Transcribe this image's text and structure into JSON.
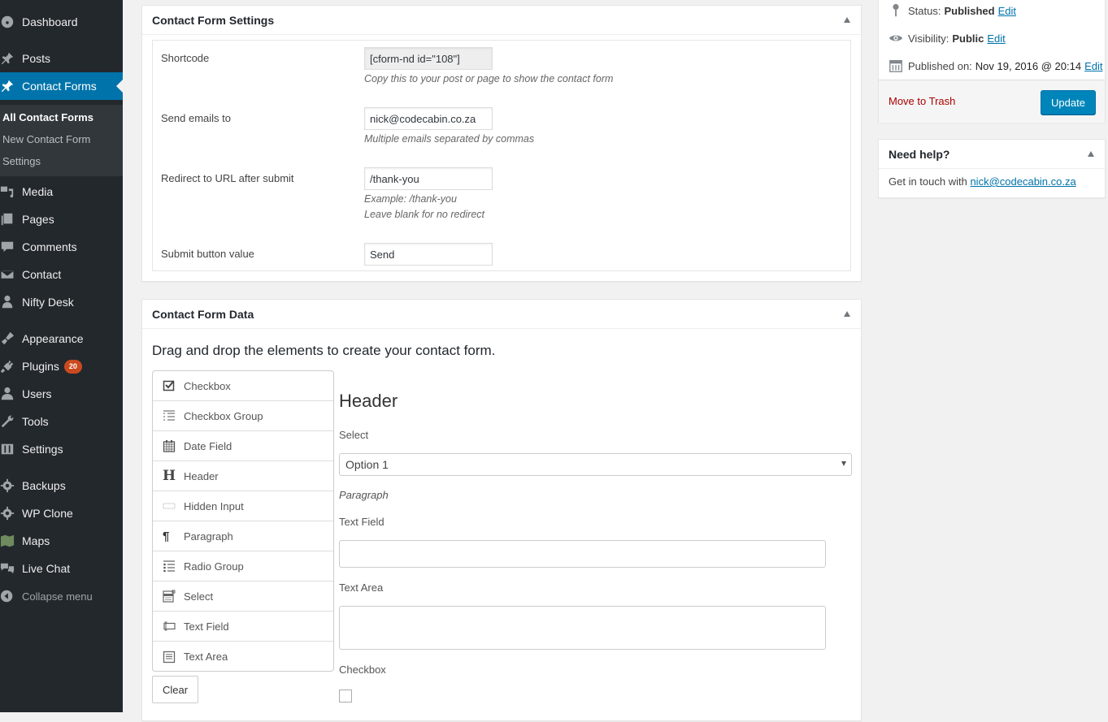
{
  "sidebar": {
    "items": [
      {
        "label": "Dashboard",
        "icon": "dashboard-icon"
      },
      {
        "label": "Posts",
        "icon": "pin-icon"
      },
      {
        "label": "Contact Forms",
        "icon": "pin-icon",
        "current": true
      },
      {
        "label": "Media",
        "icon": "media-icon"
      },
      {
        "label": "Pages",
        "icon": "pages-icon"
      },
      {
        "label": "Comments",
        "icon": "comment-icon"
      },
      {
        "label": "Contact",
        "icon": "envelope-icon"
      },
      {
        "label": "Nifty Desk",
        "icon": "user-icon"
      },
      {
        "label": "Appearance",
        "icon": "brush-icon"
      },
      {
        "label": "Plugins",
        "icon": "plug-icon",
        "badge": "20"
      },
      {
        "label": "Users",
        "icon": "users-icon"
      },
      {
        "label": "Tools",
        "icon": "wrench-icon"
      },
      {
        "label": "Settings",
        "icon": "sliders-icon"
      },
      {
        "label": "Backups",
        "icon": "gear-icon"
      },
      {
        "label": "WP Clone",
        "icon": "gear-icon"
      },
      {
        "label": "Maps",
        "icon": "map-icon"
      },
      {
        "label": "Live Chat",
        "icon": "chat-icon"
      }
    ],
    "submenu": [
      {
        "label": "All Contact Forms",
        "current": true
      },
      {
        "label": "New Contact Form"
      },
      {
        "label": "Settings"
      }
    ],
    "collapse_label": "Collapse menu"
  },
  "settings_box": {
    "title": "Contact Form Settings",
    "fields": {
      "shortcode": {
        "label": "Shortcode",
        "value": "[cform-nd id=\"108\"]",
        "desc": "Copy this to your post or page to show the contact form"
      },
      "emails": {
        "label": "Send emails to",
        "value": "nick@codecabin.co.za",
        "desc": "Multiple emails separated by commas"
      },
      "redirect": {
        "label": "Redirect to URL after submit",
        "value": "/thank-you",
        "desc1": "Example: /thank-you",
        "desc2": "Leave blank for no redirect"
      },
      "submit": {
        "label": "Submit button value",
        "value": "Send"
      }
    }
  },
  "data_box": {
    "title": "Contact Form Data",
    "instructions": "Drag and drop the elements to create your contact form.",
    "elements": [
      {
        "label": "Checkbox",
        "icon": "checkbox-icon"
      },
      {
        "label": "Checkbox Group",
        "icon": "checklist-icon"
      },
      {
        "label": "Date Field",
        "icon": "calendar-icon"
      },
      {
        "label": "Header",
        "icon": "heading-icon"
      },
      {
        "label": "Hidden Input",
        "icon": "hidden-input-icon"
      },
      {
        "label": "Paragraph",
        "icon": "paragraph-icon"
      },
      {
        "label": "Radio Group",
        "icon": "radio-list-icon"
      },
      {
        "label": "Select",
        "icon": "select-icon"
      },
      {
        "label": "Text Field",
        "icon": "text-field-icon"
      },
      {
        "label": "Text Area",
        "icon": "text-area-icon"
      }
    ],
    "clear_label": "Clear",
    "preview": {
      "header": "Header",
      "select_label": "Select",
      "select_value": "Option 1",
      "paragraph": "Paragraph",
      "text_field_label": "Text Field",
      "text_field_value": "",
      "text_area_label": "Text Area",
      "text_area_value": "",
      "checkbox_label": "Checkbox",
      "checkbox_checked": false
    }
  },
  "publish_box": {
    "status_label": "Status:",
    "status_value": "Published",
    "visibility_label": "Visibility:",
    "visibility_value": "Public",
    "published_label": "Published on:",
    "published_value": "Nov 19, 2016 @ 20:14",
    "edit_label": "Edit",
    "trash_label": "Move to Trash",
    "update_label": "Update"
  },
  "help_box": {
    "title": "Need help?",
    "text": "Get in touch with",
    "email": "nick@codecabin.co.za"
  },
  "colors": {
    "sidebar_bg": "#23282d",
    "accent": "#0073aa",
    "button_primary": "#0085ba",
    "badge": "#ca4a1f",
    "trash": "#a00000"
  }
}
